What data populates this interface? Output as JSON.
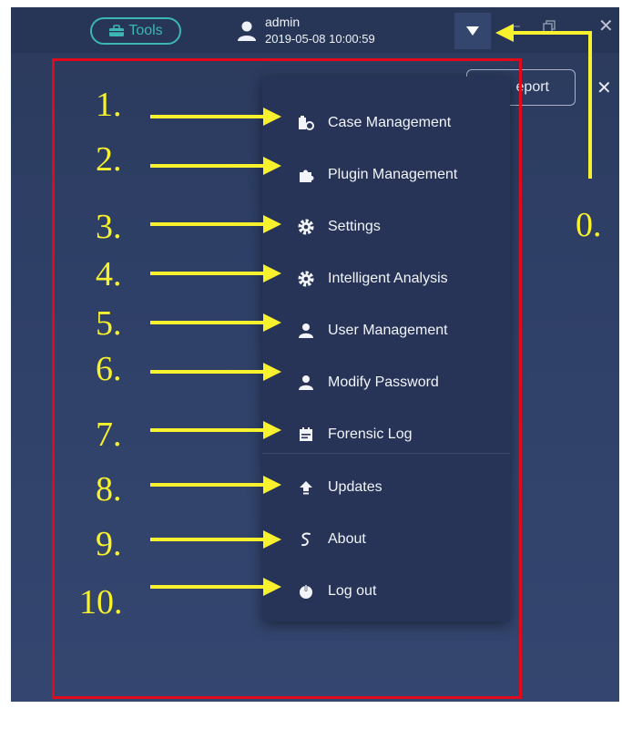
{
  "colors": {
    "window_bg": "#2f4068",
    "topbar_bg": "#273656",
    "menu_bg": "#273458",
    "teal_accent": "#3bb6b3",
    "annotation_yellow": "#f7f12e",
    "highlight_red": "#e00a1a"
  },
  "topbar": {
    "tools_label": "Tools",
    "tools_icon": "toolbox-icon",
    "user_icon": "user-icon",
    "username": "admin",
    "datetime": "2019-05-08 10:00:59",
    "dropdown_icon": "caret-down-icon",
    "window_controls": [
      "minimize",
      "restore",
      "close"
    ]
  },
  "panel": {
    "report_label": "eport",
    "close_icon": "close-icon"
  },
  "menu": {
    "items": [
      {
        "label": "Case Management",
        "icon": "case-icon"
      },
      {
        "label": "Plugin Management",
        "icon": "puzzle-icon"
      },
      {
        "label": "Settings",
        "icon": "gear-icon"
      },
      {
        "label": "Intelligent Analysis",
        "icon": "gear-icon"
      },
      {
        "label": "User Management",
        "icon": "user-icon"
      },
      {
        "label": "Modify Password",
        "icon": "user-icon"
      },
      {
        "label": "Forensic Log",
        "icon": "log-icon"
      },
      {
        "label": "Updates",
        "icon": "upload-icon"
      },
      {
        "label": "About",
        "icon": "about-icon"
      },
      {
        "label": "Log out",
        "icon": "power-icon"
      }
    ]
  },
  "annotations": {
    "labels": [
      "0.",
      "1.",
      "2.",
      "3.",
      "4.",
      "5.",
      "6.",
      "7.",
      "8.",
      "9.",
      "10."
    ]
  }
}
